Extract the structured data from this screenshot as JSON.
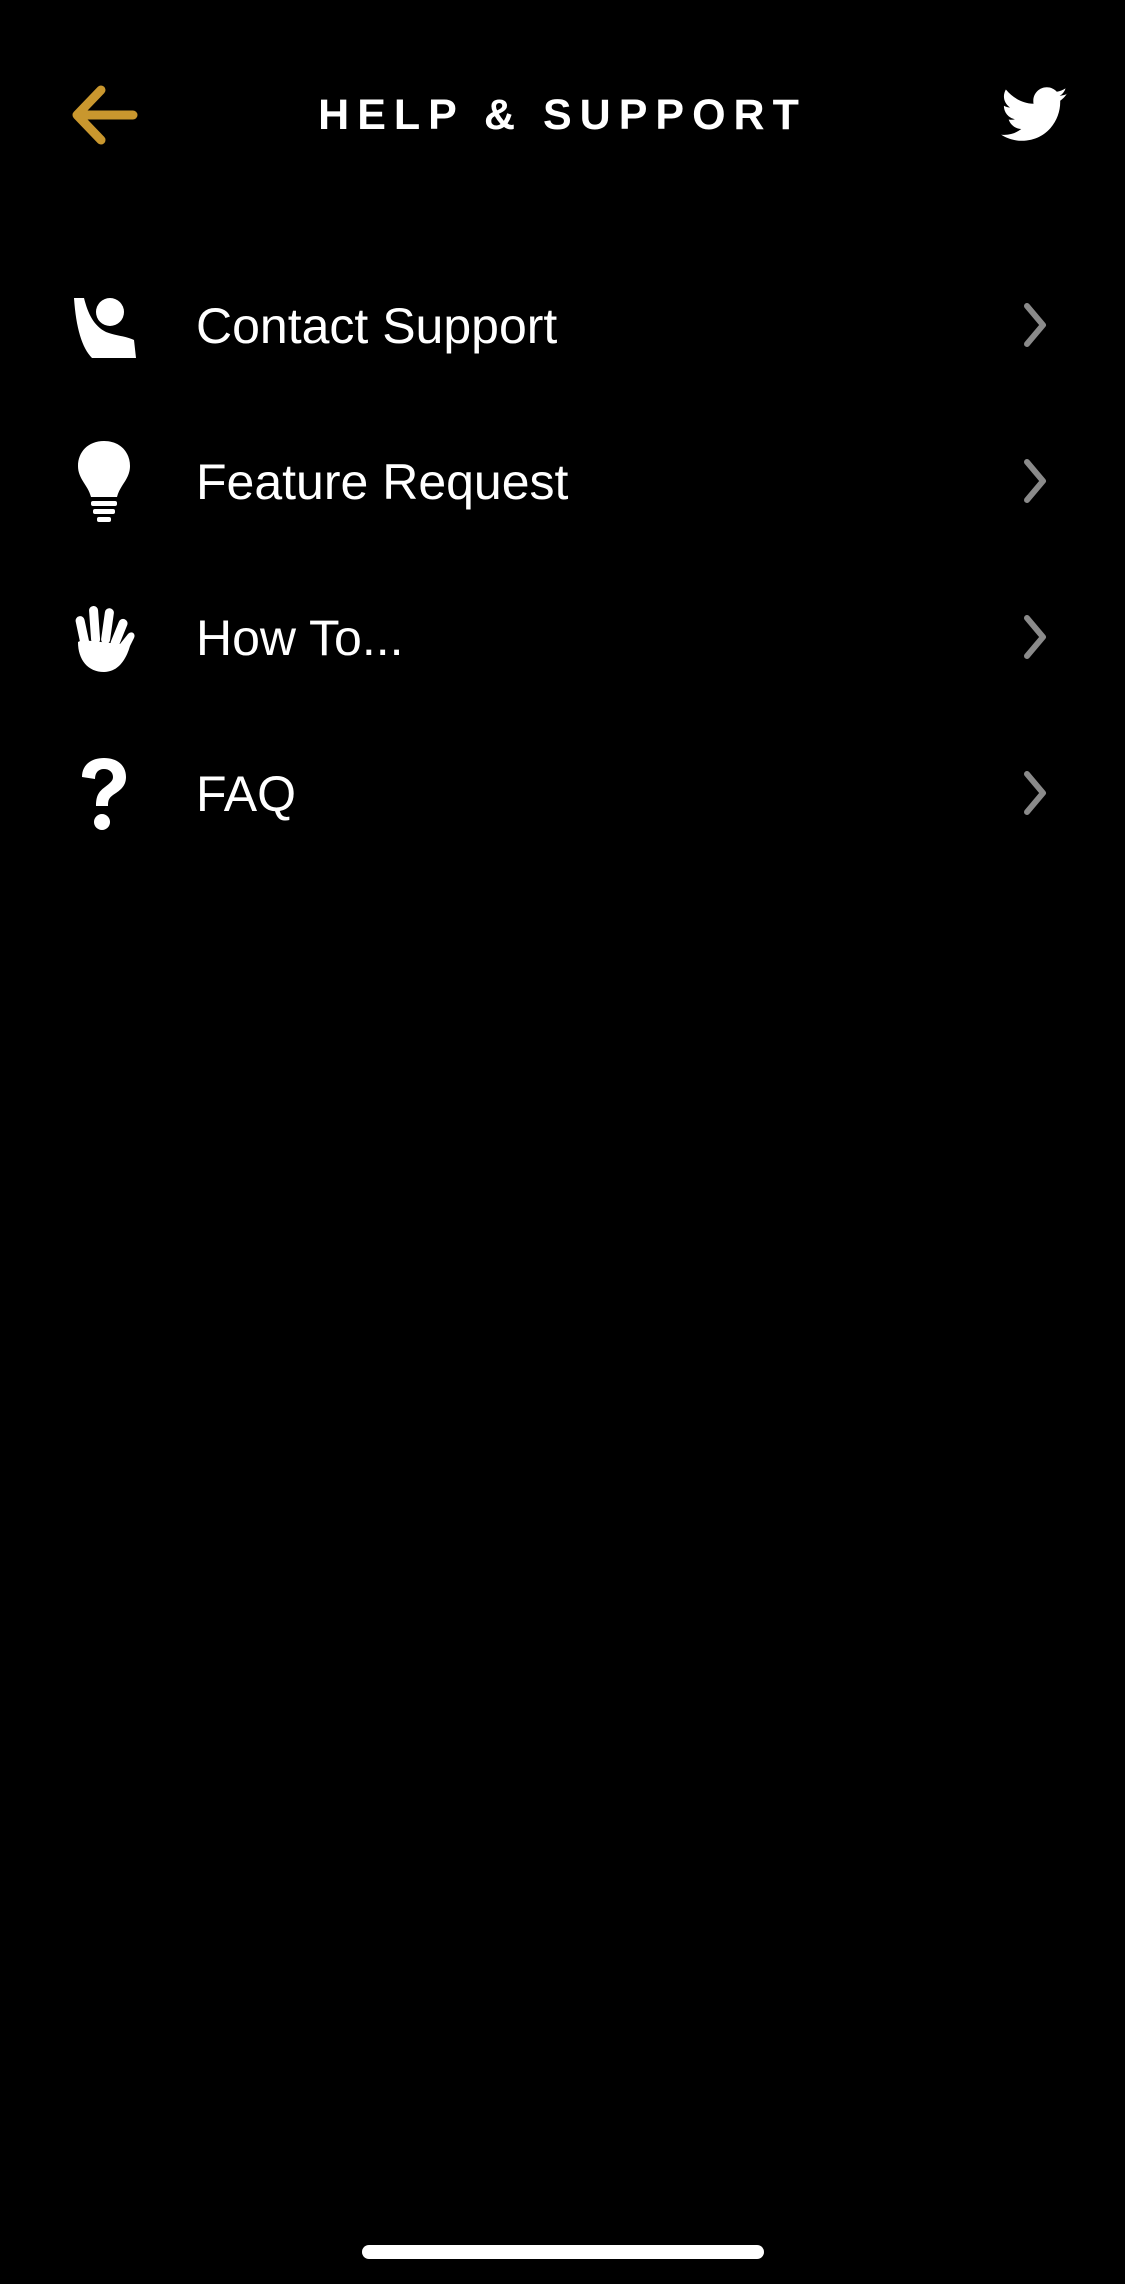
{
  "header": {
    "title": "HELP & SUPPORT",
    "back_icon": "arrow-left-icon",
    "share_icon": "twitter-icon"
  },
  "menu": {
    "items": [
      {
        "label": "Contact Support",
        "icon": "contact-support-icon"
      },
      {
        "label": "Feature Request",
        "icon": "lightbulb-icon"
      },
      {
        "label": "How To...",
        "icon": "hand-icon"
      },
      {
        "label": "FAQ",
        "icon": "question-mark-icon"
      }
    ]
  },
  "colors": {
    "background": "#000000",
    "accent": "#C9972E",
    "text": "#FFFFFF",
    "chevron": "#8A8A8A"
  }
}
